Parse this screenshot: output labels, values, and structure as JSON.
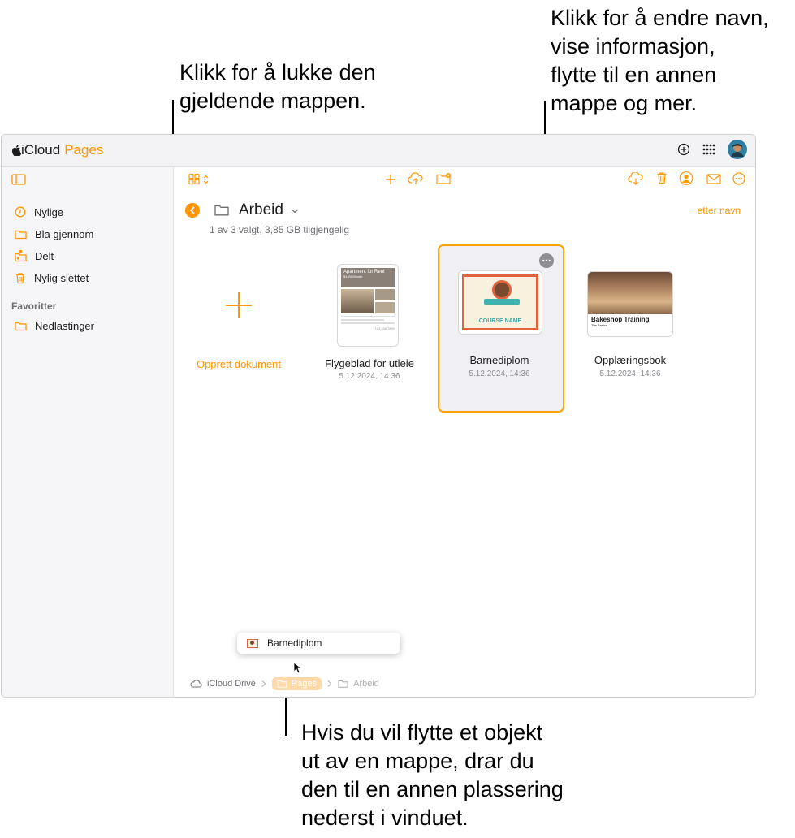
{
  "callouts": {
    "close_folder": "Klikk for å lukke den\ngjeldende mappen.",
    "more_options": "Klikk for å endre navn,\nvise informasjon,\nflytte til en annen\nmappe og mer.",
    "move_out": "Hvis du vil flytte et objekt\nut av en mappe, drar du\nden til en annen plassering\nnederst i vinduet."
  },
  "app": {
    "logo_prefix": "iCloud",
    "logo_brand": "Pages"
  },
  "sidebar": {
    "items": [
      {
        "label": "Nylige",
        "icon": "clock-icon"
      },
      {
        "label": "Bla gjennom",
        "icon": "folder-icon"
      },
      {
        "label": "Delt",
        "icon": "shared-folder-icon"
      },
      {
        "label": "Nylig slettet",
        "icon": "trash-icon"
      }
    ],
    "favorites_heading": "Favoritter",
    "favorites": [
      {
        "label": "Nedlastinger",
        "icon": "folder-icon"
      }
    ]
  },
  "folder": {
    "title": "Arbeid",
    "subtitle": "1 av 3 valgt, 3,85 GB tilgjengelig",
    "sort_label": "etter navn"
  },
  "documents": {
    "create_label": "Opprett dokument",
    "items": [
      {
        "name": "Flygeblad for utleie",
        "date": "5.12.2024, 14:36",
        "thumb_title": "Apartment for Rent",
        "thumb_sub": "$1400/Month",
        "thumb_phone": "123 456 7890"
      },
      {
        "name": "Barnediplom",
        "date": "5.12.2024, 14:36",
        "thumb_title": "COURSE NAME",
        "selected": true
      },
      {
        "name": "Opplæringsbok",
        "date": "5.12.2024, 14:36",
        "thumb_title": "Bakeshop Training",
        "thumb_sub": "The Basics"
      }
    ]
  },
  "drag": {
    "label": "Barnediplom"
  },
  "breadcrumb": [
    "iCloud Drive",
    "Pages",
    "Arbeid"
  ],
  "colors": {
    "accent": "#ff9500",
    "selection": "#ff9f0a"
  }
}
